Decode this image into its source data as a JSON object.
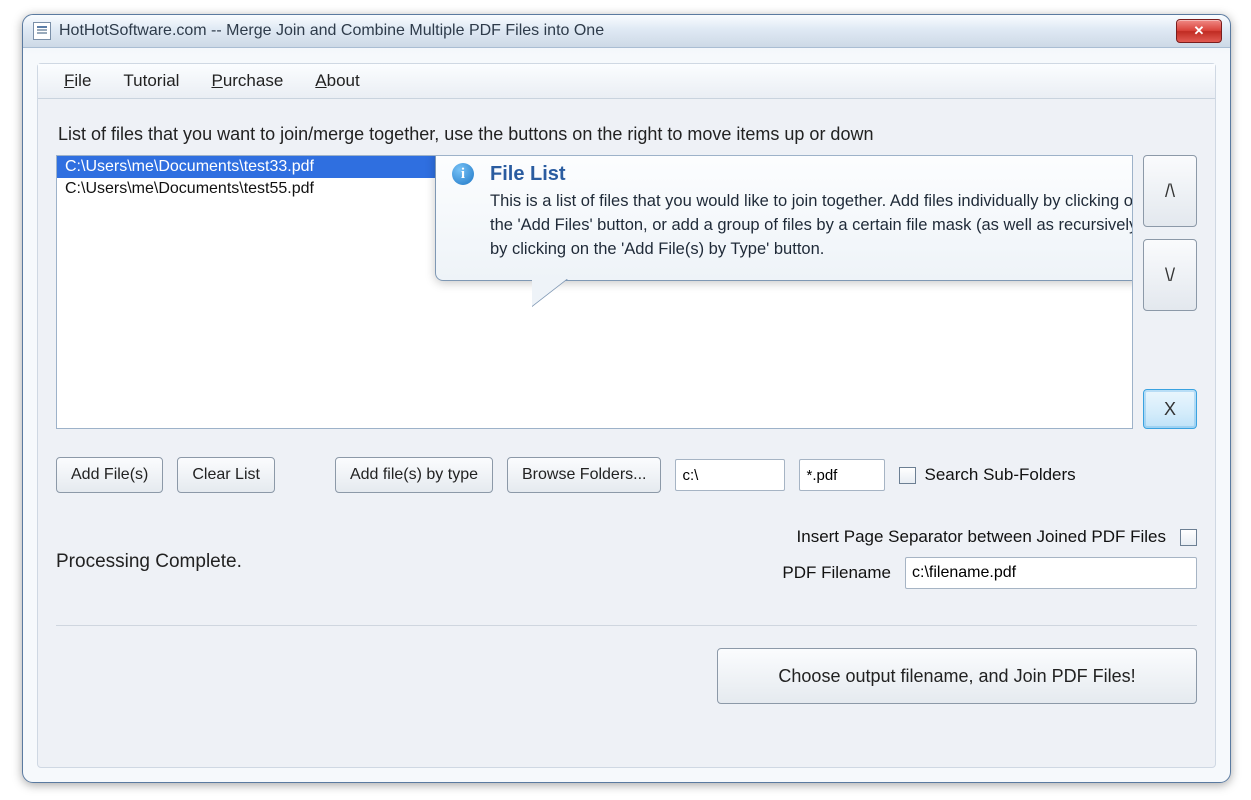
{
  "window": {
    "title": "HotHotSoftware.com -- Merge Join and Combine Multiple PDF Files into One"
  },
  "menu": {
    "file": "File",
    "tutorial": "Tutorial",
    "purchase": "Purchase",
    "about": "About"
  },
  "instruction": "List of files that you want to join/merge together, use the buttons on the right to move items up or down",
  "files": [
    "C:\\Users\\me\\Documents\\test33.pdf",
    "C:\\Users\\me\\Documents\\test55.pdf"
  ],
  "side": {
    "up": "/\\",
    "down": "\\/",
    "remove": "X"
  },
  "buttons": {
    "add_files": "Add File(s)",
    "clear_list": "Clear List",
    "add_by_type": "Add file(s) by type",
    "browse_folders": "Browse Folders...",
    "choose_output": "Choose output filename, and Join PDF Files!"
  },
  "inputs": {
    "path": "c:\\",
    "mask": "*.pdf",
    "pdf_filename": "c:\\filename.pdf"
  },
  "labels": {
    "search_sub": "Search Sub-Folders",
    "insert_sep": "Insert Page Separator between Joined PDF Files",
    "pdf_filename": "PDF Filename"
  },
  "status": "Processing Complete.",
  "tooltip": {
    "title": "File List",
    "body": "This is a list of files that you would like to join together. Add files individually by clicking on the 'Add Files' button, or add a group of files by a certain file mask (as well as recursively) by clicking on the 'Add File(s) by Type' button."
  }
}
